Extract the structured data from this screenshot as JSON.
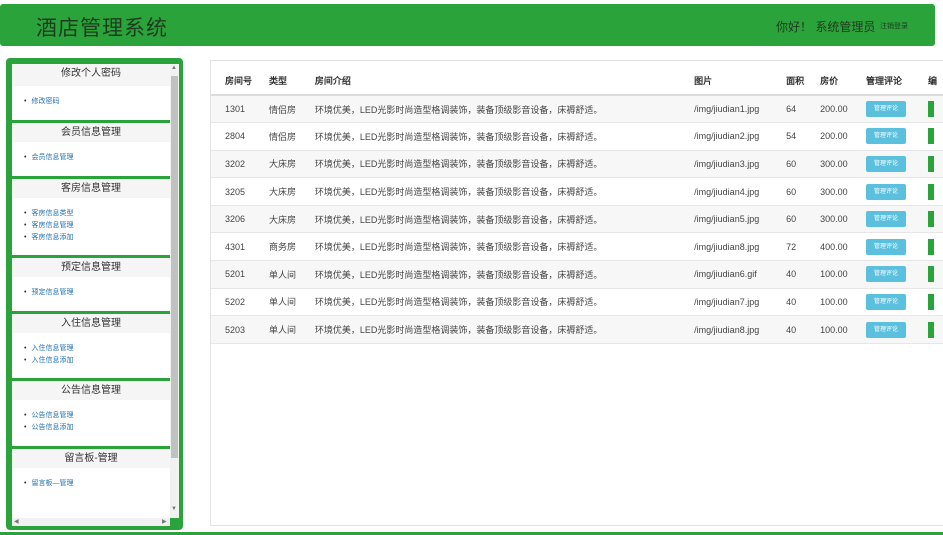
{
  "header": {
    "title": "酒店管理系统",
    "greeting": "你好！ 系统管理员",
    "logout": "注销登录"
  },
  "sidebar": {
    "groups": [
      {
        "title": "修改个人密码",
        "items": [
          "修改密码"
        ]
      },
      {
        "title": "会员信息管理",
        "items": [
          "会员信息管理"
        ]
      },
      {
        "title": "客房信息管理",
        "items": [
          "客房信息类型",
          "客房信息管理",
          "客房信息添加"
        ]
      },
      {
        "title": "预定信息管理",
        "items": [
          "预定信息管理"
        ]
      },
      {
        "title": "入住信息管理",
        "items": [
          "入住信息管理",
          "入住信息添加"
        ]
      },
      {
        "title": "公告信息管理",
        "items": [
          "公告信息管理",
          "公告信息添加"
        ]
      },
      {
        "title": "留言板-管理",
        "items": [
          "留言板—管理"
        ]
      }
    ]
  },
  "table": {
    "columns": [
      "房间号",
      "类型",
      "房间介绍",
      "图片",
      "面积",
      "房价",
      "管理评论",
      "编"
    ],
    "button_label": "管理评论",
    "rows": [
      {
        "no": "1301",
        "type": "情侣房",
        "desc": "环境优美，LED光影时尚造型格调装饰，装备顶级影音设备，床褥舒适。",
        "img": "/img/jiudian1.jpg",
        "area": "64",
        "price": "200.00"
      },
      {
        "no": "2804",
        "type": "情侣房",
        "desc": "环境优美，LED光影时尚造型格调装饰，装备顶级影音设备，床褥舒适。",
        "img": "/img/jiudian2.jpg",
        "area": "54",
        "price": "200.00"
      },
      {
        "no": "3202",
        "type": "大床房",
        "desc": "环境优美，LED光影时尚造型格调装饰，装备顶级影音设备，床褥舒适。",
        "img": "/img/jiudian3.jpg",
        "area": "60",
        "price": "300.00"
      },
      {
        "no": "3205",
        "type": "大床房",
        "desc": "环境优美，LED光影时尚造型格调装饰，装备顶级影音设备，床褥舒适。",
        "img": "/img/jiudian4.jpg",
        "area": "60",
        "price": "300.00"
      },
      {
        "no": "3206",
        "type": "大床房",
        "desc": "环境优美，LED光影时尚造型格调装饰，装备顶级影音设备，床褥舒适。",
        "img": "/img/jiudian5.jpg",
        "area": "60",
        "price": "300.00"
      },
      {
        "no": "4301",
        "type": "商务房",
        "desc": "环境优美，LED光影时尚造型格调装饰，装备顶级影音设备，床褥舒适。",
        "img": "/img/jiudian8.jpg",
        "area": "72",
        "price": "400.00"
      },
      {
        "no": "5201",
        "type": "单人间",
        "desc": "环境优美，LED光影时尚造型格调装饰，装备顶级影音设备，床褥舒适。",
        "img": "/img/jiudian6.gif",
        "area": "40",
        "price": "100.00"
      },
      {
        "no": "5202",
        "type": "单人间",
        "desc": "环境优美，LED光影时尚造型格调装饰，装备顶级影音设备，床褥舒适。",
        "img": "/img/jiudian7.jpg",
        "area": "40",
        "price": "100.00"
      },
      {
        "no": "5203",
        "type": "单人间",
        "desc": "环境优美，LED光影时尚造型格调装饰，装备顶级影音设备，床褥舒适。",
        "img": "/img/jiudian8.jpg",
        "area": "40",
        "price": "100.00"
      }
    ]
  }
}
